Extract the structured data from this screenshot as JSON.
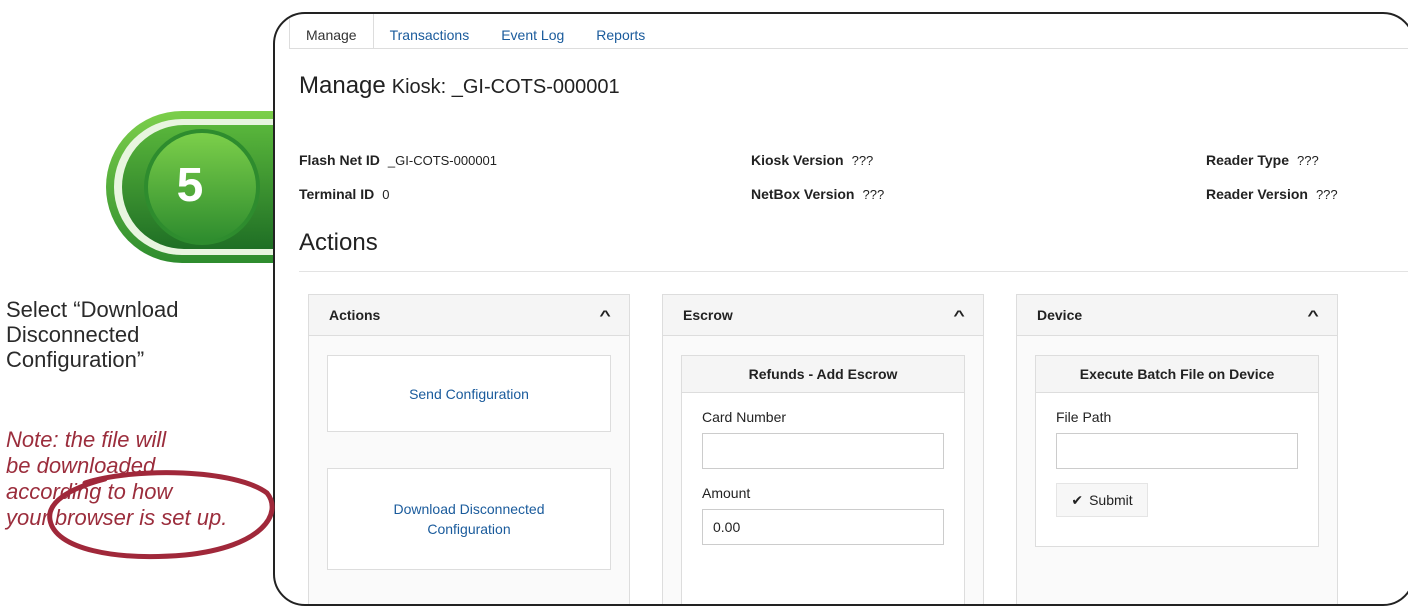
{
  "step": {
    "number": "5"
  },
  "instruction": {
    "text_lines": [
      "Select “Download",
      "Disconnected",
      "Configuration”"
    ],
    "note_lines": [
      "Note: the file will",
      "be downloaded",
      "according to how",
      "your browser is set up."
    ]
  },
  "tabs": [
    "Manage",
    "Transactions",
    "Event Log",
    "Reports"
  ],
  "page": {
    "title": "Manage",
    "subtitle": "Kiosk: _GI-COTS-000001"
  },
  "info": {
    "flash_net_id": {
      "label": "Flash Net ID",
      "value": "_GI-COTS-000001"
    },
    "terminal_id": {
      "label": "Terminal ID",
      "value": "0"
    },
    "kiosk_version": {
      "label": "Kiosk Version",
      "value": "???"
    },
    "netbox_version": {
      "label": "NetBox Version",
      "value": "???"
    },
    "reader_type": {
      "label": "Reader Type",
      "value": "???"
    },
    "reader_version": {
      "label": "Reader Version",
      "value": "???"
    }
  },
  "actions_section": {
    "title": "Actions"
  },
  "panels": {
    "actions": {
      "title": "Actions",
      "send_config": "Send Configuration",
      "download_config_lines": [
        "Download Disconnected",
        "Configuration"
      ]
    },
    "escrow": {
      "title": "Escrow",
      "sub_title": "Refunds - Add Escrow",
      "card_number_label": "Card Number",
      "card_number_value": "",
      "amount_label": "Amount",
      "amount_value": "0.00"
    },
    "device": {
      "title": "Device",
      "sub_title": "Execute Batch File on Device",
      "file_path_label": "File Path",
      "file_path_value": "",
      "submit_label": "Submit"
    }
  },
  "colors": {
    "accent_link": "#1a5b9c",
    "badge_green": "#3aa63a",
    "highlight_ellipse": "#a0283a",
    "note_text": "#9b2d3c"
  },
  "icons": {
    "collapse": "chevron-up-icon",
    "submit": "check-icon"
  }
}
